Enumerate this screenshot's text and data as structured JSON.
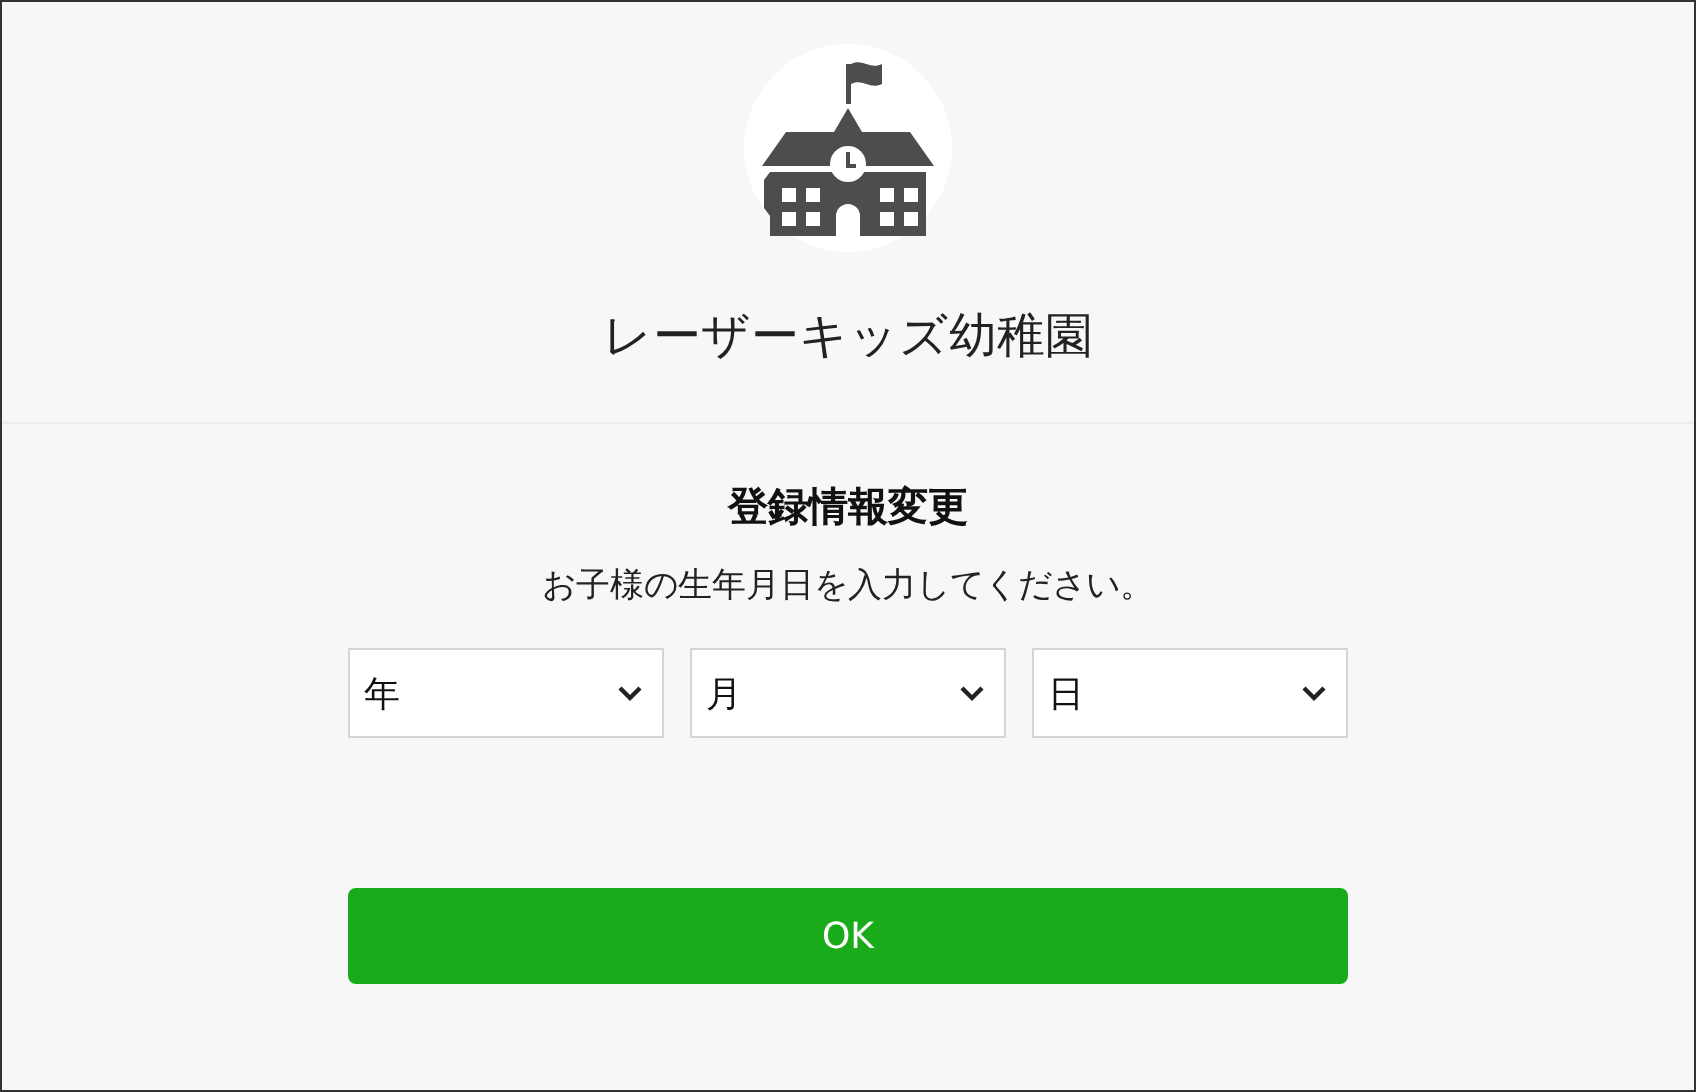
{
  "header": {
    "title": "レーザーキッズ幼稚園"
  },
  "form": {
    "heading": "登録情報変更",
    "instruction": "お子様の生年月日を入力してください。",
    "dropdowns": [
      {
        "placeholder": "年"
      },
      {
        "placeholder": "月"
      },
      {
        "placeholder": "日"
      }
    ],
    "button": "OK"
  }
}
